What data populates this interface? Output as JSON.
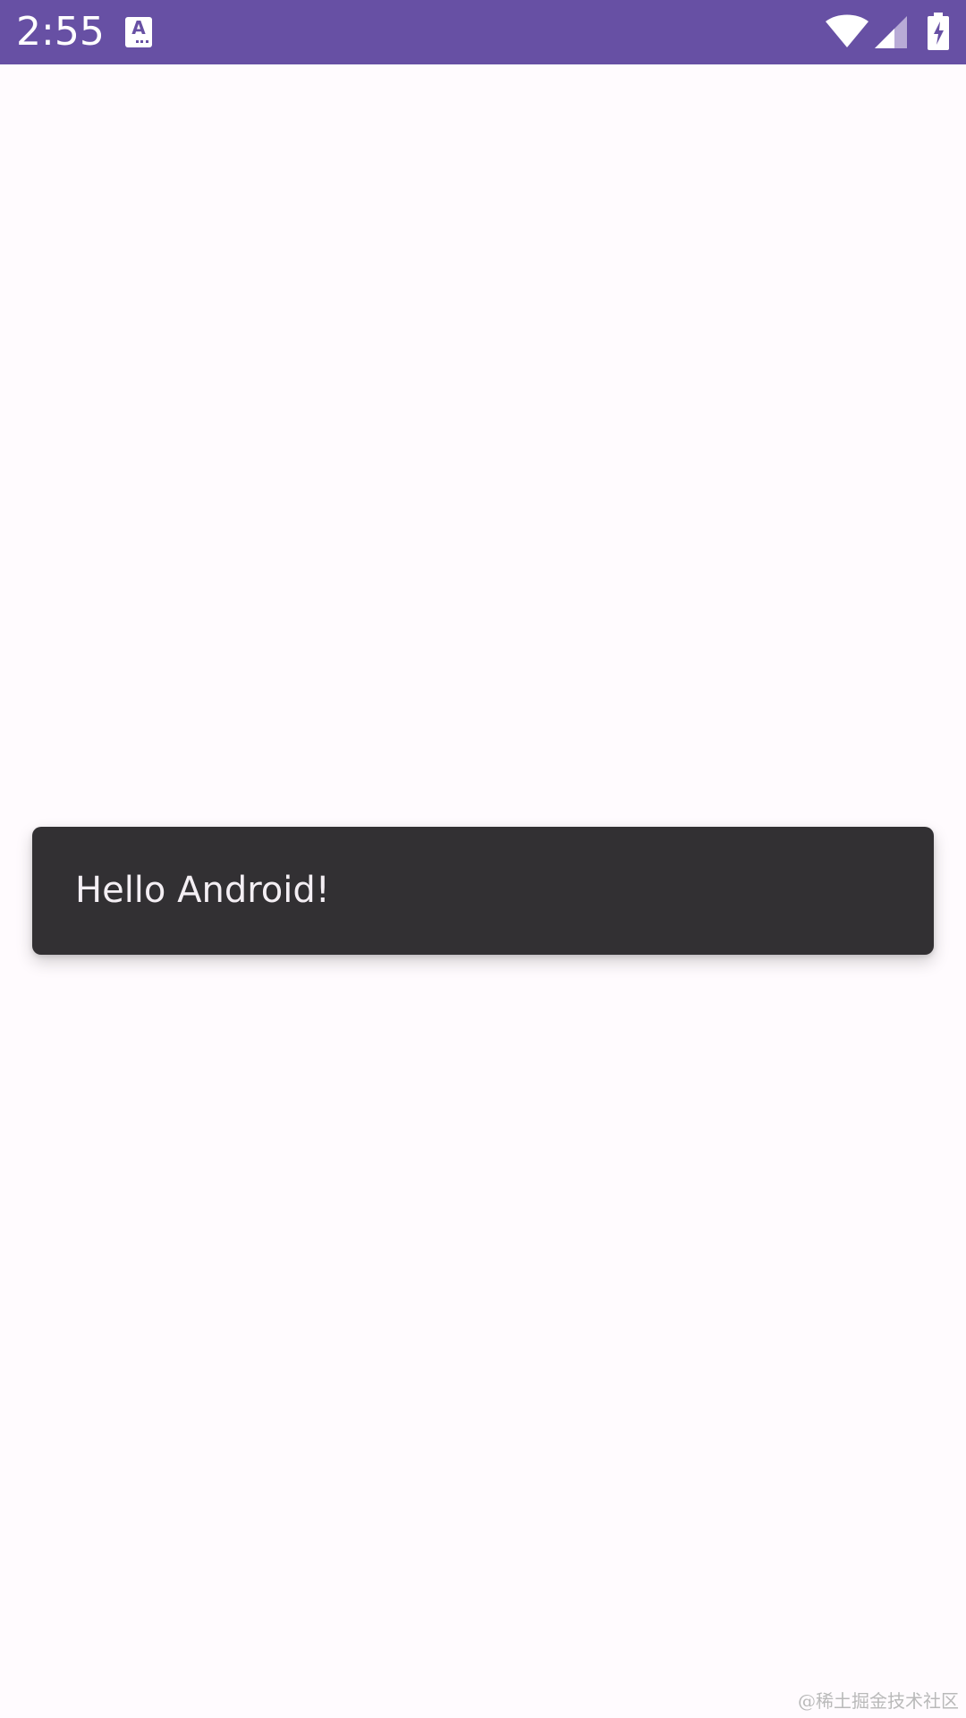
{
  "status_bar": {
    "time": "2:55",
    "background_color": "#6750a4",
    "icons": {
      "notification": "a-keyboard-icon",
      "wifi": "wifi-icon",
      "signal": "signal-icon",
      "battery": "battery-charging-icon"
    },
    "notification_glyph": "A"
  },
  "toast": {
    "message": "Hello Android!",
    "background_color": "#323033"
  },
  "watermark": {
    "text": "@稀土掘金技术社区"
  },
  "colors": {
    "page_background": "#fffbfe",
    "toast_text": "#f4eff4"
  }
}
